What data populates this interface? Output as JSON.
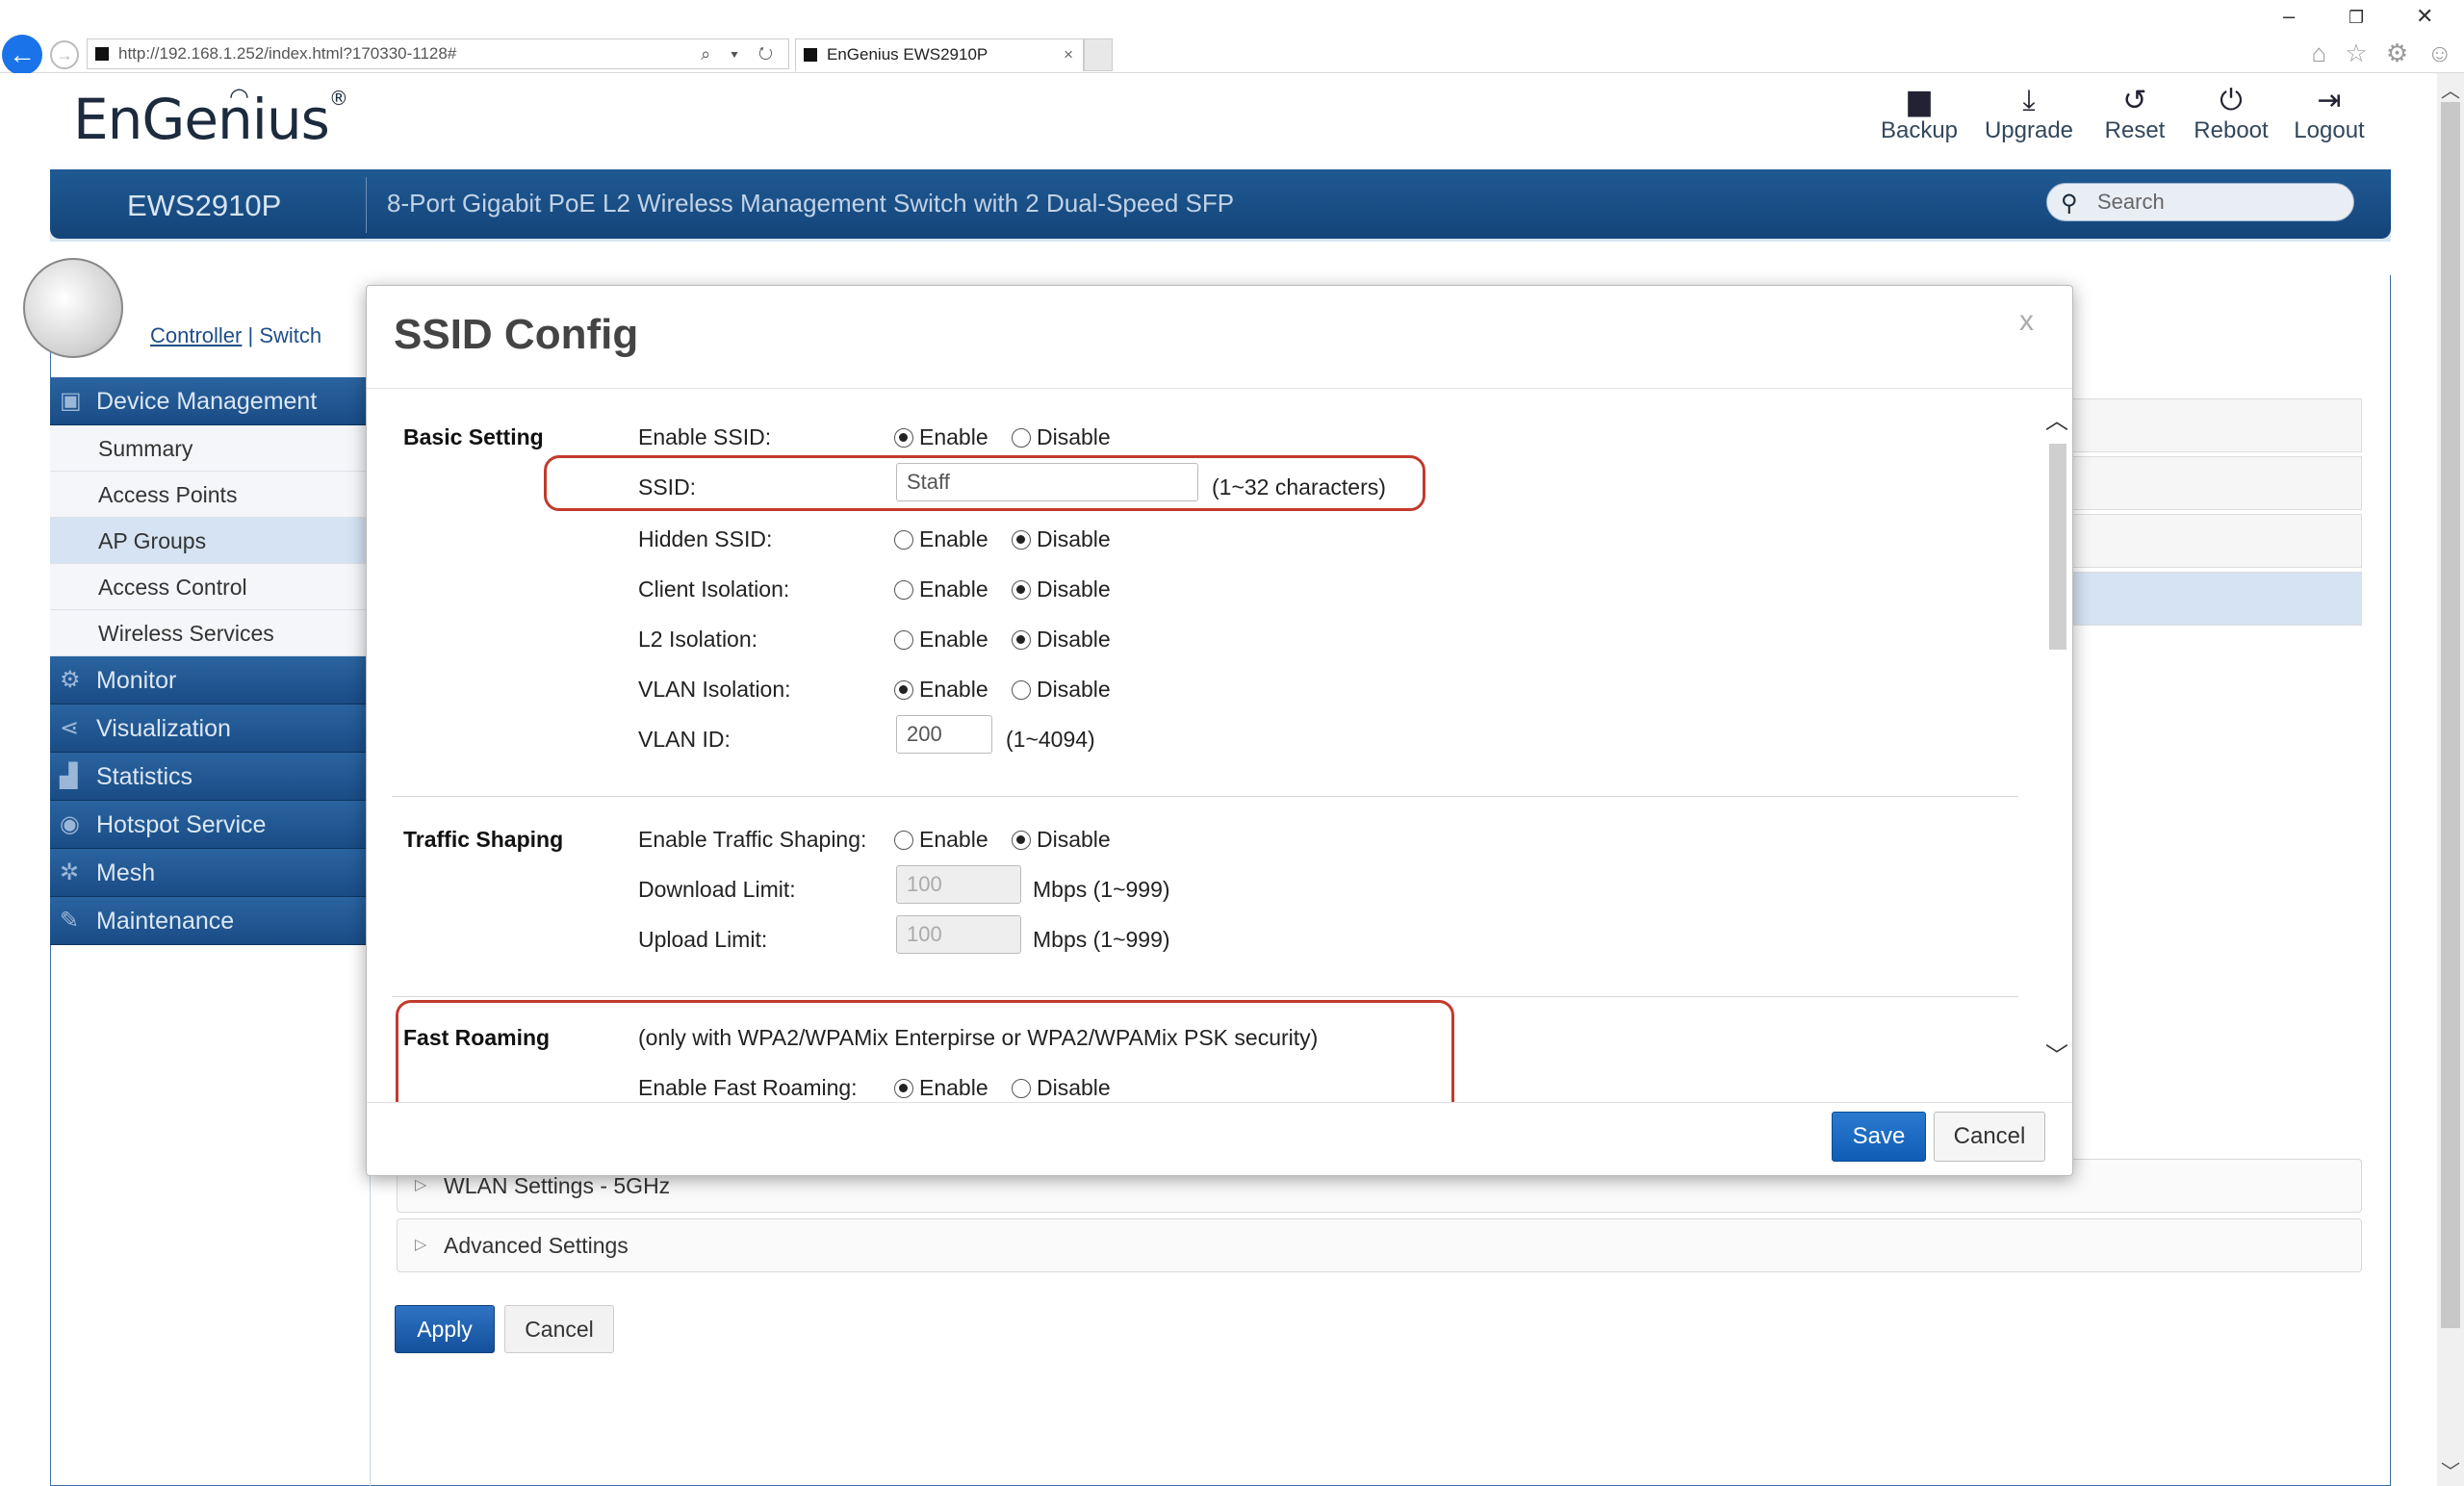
{
  "browser": {
    "url": "http://192.168.1.252/index.html?170330-1128#",
    "tab_title": "EnGenius EWS2910P",
    "tab_close": "×",
    "min": "–",
    "restore": "❐",
    "close": "✕",
    "nav_icons": "⌂ ☆ ⚙ ☺",
    "addr_tools": "⌕ ▾ ↻"
  },
  "header": {
    "logo": "EnGenius",
    "registered": "®",
    "model": "EWS2910P",
    "subtitle": "8-Port Gigabit PoE L2 Wireless Management Switch with 2 Dual-Speed SFP",
    "search_placeholder": "Search",
    "buttons": [
      {
        "label": "Backup",
        "icon": "save-icon"
      },
      {
        "label": "Upgrade",
        "icon": "download-icon"
      },
      {
        "label": "Reset",
        "icon": "reset-icon"
      },
      {
        "label": "Reboot",
        "icon": "power-icon"
      },
      {
        "label": "Logout",
        "icon": "logout-icon"
      }
    ]
  },
  "controller_switch": {
    "controller": "Controller",
    "sep": "|",
    "switch": "Switch"
  },
  "sidebar": {
    "device_management": "Device Management",
    "items": [
      "Summary",
      "Access Points",
      "AP Groups",
      "Access Control",
      "Wireless Services"
    ],
    "monitor": "Monitor",
    "visualization": "Visualization",
    "statistics": "Statistics",
    "hotspot": "Hotspot Service",
    "mesh": "Mesh",
    "maintenance": "Maintenance"
  },
  "background": {
    "wlan5": "WLAN Settings - 5GHz",
    "advanced": "Advanced Settings",
    "apply": "Apply",
    "cancel": "Cancel"
  },
  "modal": {
    "title": "SSID Config",
    "close": "x",
    "basic": {
      "section": "Basic Setting",
      "enable_ssid": "Enable SSID:",
      "ssid": "SSID:",
      "ssid_value": "Staff",
      "ssid_hint": "(1~32 characters)",
      "hidden_ssid": "Hidden SSID:",
      "client_isolation": "Client Isolation:",
      "l2_isolation": "L2 Isolation:",
      "vlan_isolation": "VLAN Isolation:",
      "vlan_id": "VLAN ID:",
      "vlan_id_value": "200",
      "vlan_hint": "(1~4094)"
    },
    "traffic": {
      "section": "Traffic Shaping",
      "enable": "Enable Traffic Shaping:",
      "download": "Download Limit:",
      "download_value": "100",
      "upload": "Upload Limit:",
      "upload_value": "100",
      "unit": "Mbps (1~999)"
    },
    "roaming": {
      "section": "Fast Roaming",
      "note": "(only with WPA2/WPAMix Enterpirse or WPA2/WPAMix PSK security)",
      "enable": "Enable Fast Roaming:"
    },
    "enable_text": "Enable",
    "disable_text": "Disable",
    "save": "Save",
    "cancel": "Cancel"
  }
}
